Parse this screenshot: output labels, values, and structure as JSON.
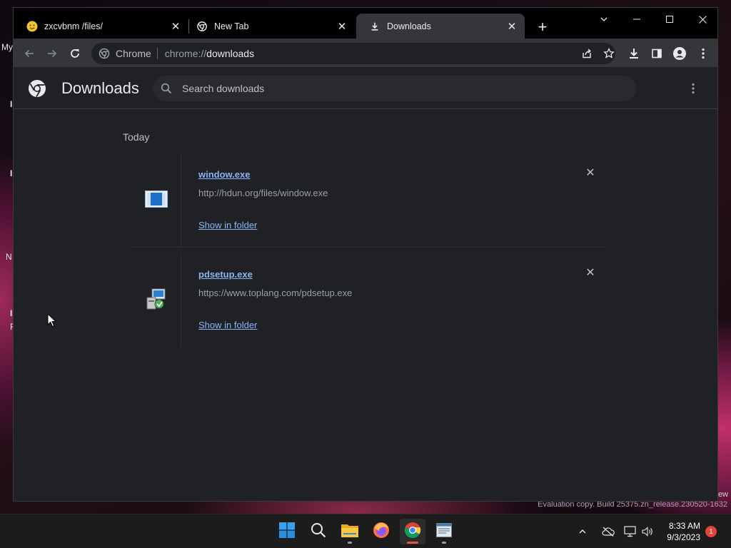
{
  "desktop": {
    "fragments": [
      "My",
      "I",
      "I",
      "N",
      "I",
      "F"
    ],
    "watermark": "Evaluation copy. Build 25375.zn_release.230520-1632",
    "watermark_edge": "ew"
  },
  "browser": {
    "tabs": [
      {
        "title": "zxcvbnm /files/",
        "favicon": "smiley-face-icon",
        "active": false
      },
      {
        "title": "New Tab",
        "favicon": "chrome-icon",
        "active": false
      },
      {
        "title": "Downloads",
        "favicon": "download-icon",
        "active": true
      }
    ],
    "omnibox": {
      "site_chip": "Chrome",
      "url_scheme": "chrome://",
      "url_host": "downloads"
    }
  },
  "downloads_page": {
    "title": "Downloads",
    "search_placeholder": "Search downloads",
    "date_header": "Today",
    "items": [
      {
        "filename": "window.exe",
        "url": "http://hdun.org/files/window.exe",
        "action": "Show in folder",
        "icon": "exe-window-icon"
      },
      {
        "filename": "pdsetup.exe",
        "url": "https://www.toplang.com/pdsetup.exe",
        "action": "Show in folder",
        "icon": "installer-icon"
      }
    ]
  },
  "taskbar": {
    "apps": [
      "start-icon",
      "search-icon",
      "file-explorer-icon",
      "firefox-icon",
      "chrome-icon",
      "notepad-icon"
    ],
    "clock_time": "8:33 AM",
    "clock_date": "9/3/2023",
    "notification_count": "1"
  },
  "colors": {
    "link": "#8ab4f8",
    "page_bg": "#202124",
    "toolbar_bg": "#35363a"
  }
}
